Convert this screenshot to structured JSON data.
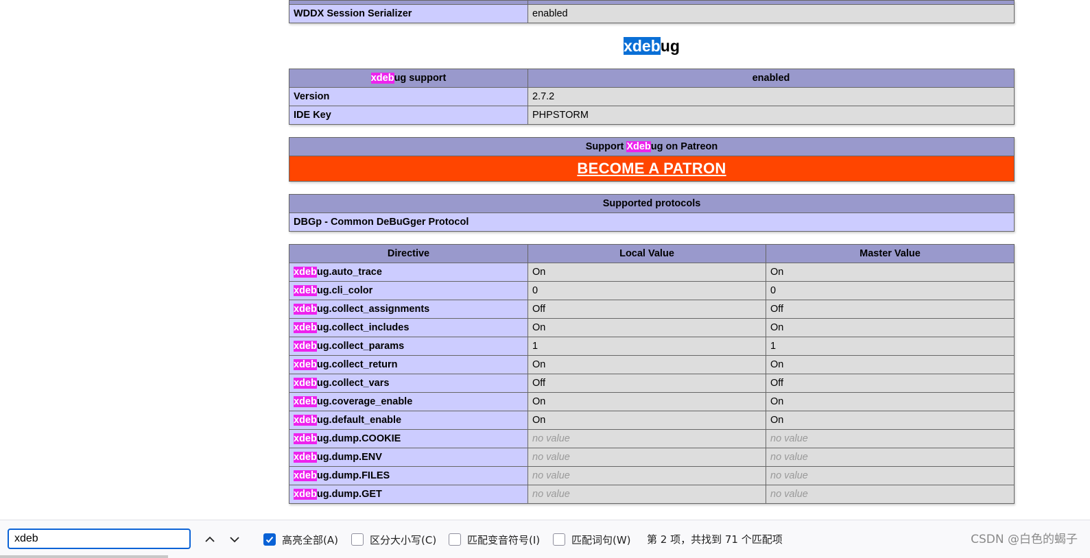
{
  "top_table": {
    "row": {
      "label": "WDDX Session Serializer",
      "value": "enabled"
    }
  },
  "section": {
    "title_hl": "xdeb",
    "title_rest": "ug"
  },
  "support_table": {
    "header_hl": "xdeb",
    "header_rest": "ug support",
    "header_value": "enabled",
    "rows": [
      {
        "label": "Version",
        "value": "2.7.2"
      },
      {
        "label": "IDE Key",
        "value": "PHPSTORM"
      }
    ]
  },
  "patreon": {
    "header_pre": "Support ",
    "header_hl": "Xdeb",
    "header_post": "ug on Patreon",
    "link": "BECOME A PATRON"
  },
  "protocols": {
    "header": "Supported protocols",
    "row": "DBGp - Common DeBuGger Protocol"
  },
  "directives": {
    "headers": [
      "Directive",
      "Local Value",
      "Master Value"
    ],
    "hl": "xdeb",
    "rows": [
      {
        "rest": "ug.auto_trace",
        "local": "On",
        "master": "On"
      },
      {
        "rest": "ug.cli_color",
        "local": "0",
        "master": "0"
      },
      {
        "rest": "ug.collect_assignments",
        "local": "Off",
        "master": "Off"
      },
      {
        "rest": "ug.collect_includes",
        "local": "On",
        "master": "On"
      },
      {
        "rest": "ug.collect_params",
        "local": "1",
        "master": "1"
      },
      {
        "rest": "ug.collect_return",
        "local": "On",
        "master": "On"
      },
      {
        "rest": "ug.collect_vars",
        "local": "Off",
        "master": "Off"
      },
      {
        "rest": "ug.coverage_enable",
        "local": "On",
        "master": "On"
      },
      {
        "rest": "ug.default_enable",
        "local": "On",
        "master": "On"
      },
      {
        "rest": "ug.dump.COOKIE",
        "local": "no value",
        "master": "no value",
        "novalue": true
      },
      {
        "rest": "ug.dump.ENV",
        "local": "no value",
        "master": "no value",
        "novalue": true
      },
      {
        "rest": "ug.dump.FILES",
        "local": "no value",
        "master": "no value",
        "novalue": true
      },
      {
        "rest": "ug.dump.GET",
        "local": "no value",
        "master": "no value",
        "novalue": true
      }
    ]
  },
  "findbar": {
    "query": "xdeb",
    "prev_icon": "chevron-up-icon",
    "next_icon": "chevron-down-icon",
    "options": [
      {
        "label": "高亮全部(A)",
        "checked": true
      },
      {
        "label": "区分大小写(C)",
        "checked": false
      },
      {
        "label": "匹配变音符号(I)",
        "checked": false
      },
      {
        "label": "匹配词句(W)",
        "checked": false
      }
    ],
    "status": "第 2 项，共找到 71 个匹配项"
  },
  "watermark": "CSDN @白色的蝎子",
  "colors": {
    "header_bg": "#9999cc",
    "label_bg": "#ccccff",
    "value_bg": "#dddddd",
    "highlight": "#ee22ee",
    "current_highlight": "#0a6fd6",
    "patron_bg": "#ff4500",
    "accent": "#0a62d6"
  }
}
